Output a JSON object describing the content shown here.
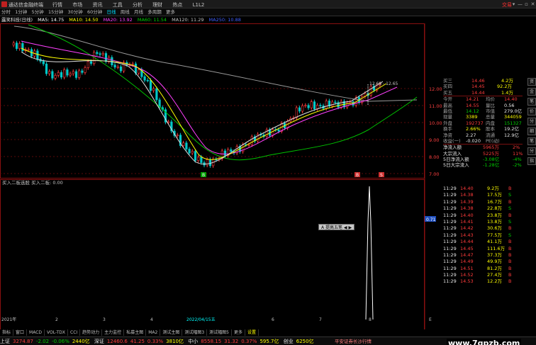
{
  "app": {
    "title": "通达信金融终端",
    "menu": [
      "行情",
      "市场",
      "资讯",
      "工具",
      "分析",
      "理财",
      "热点",
      "L1L2"
    ],
    "trade_label": "交易",
    "window_controls": [
      "▾",
      "—",
      "▫",
      "✕"
    ]
  },
  "period_tabs": [
    "分时",
    "1分钟",
    "5分钟",
    "15分钟",
    "30分钟",
    "60分钟",
    "日线",
    "周线",
    "月线",
    "多周期",
    "更多"
  ],
  "active_period": "日线",
  "ma_line": {
    "name": "露笑科技(日线)",
    "items": [
      {
        "label": "MA5: 14.75",
        "color": "#ffffff"
      },
      {
        "label": "MA10: 14.50",
        "color": "#ffff00"
      },
      {
        "label": "MA20: 13.92",
        "color": "#ff40ff"
      },
      {
        "label": "MA60: 11.54",
        "color": "#00d000"
      },
      {
        "label": "MA120: 11.29",
        "color": "#c0c0c0"
      },
      {
        "label": "MA250: 10.88",
        "color": "#4060ff"
      }
    ]
  },
  "price_axis": [
    "12.00",
    "11.00",
    "10.00",
    "9.00",
    "8.00",
    "7.00"
  ],
  "annotation_range": "12.69 - 12.65",
  "kline_markers": [
    "B",
    "B",
    "S"
  ],
  "sub_indicator": {
    "title": "买入二板选股  买入二板: 0.00",
    "axis_value": "0.71"
  },
  "time_axis": [
    "2021年",
    "2",
    "3",
    "4",
    "2022/04/15五",
    "6",
    "7",
    "8",
    "E"
  ],
  "popup_label": "A 提高五笔 ◀ ▶",
  "quote_top": [
    {
      "label": "买三",
      "price": "14.46",
      "vol": "4.2万"
    },
    {
      "label": "买四",
      "price": "14.45",
      "vol": "92.2万"
    },
    {
      "label": "买五",
      "price": "14.44",
      "vol": "1.4万"
    }
  ],
  "quote_stats": [
    {
      "l1": "今开",
      "v1": "14.21",
      "c1": "red",
      "l2": "均价",
      "v2": "14.40",
      "c2": "red"
    },
    {
      "l1": "最高",
      "v1": "14.55",
      "c1": "red",
      "l2": "量比",
      "v2": "0.56",
      "c2": "white"
    },
    {
      "l1": "最低",
      "v1": "14.12",
      "c1": "green",
      "l2": "市值",
      "v2": "279.0亿",
      "c2": "white"
    },
    {
      "l1": "现量",
      "v1": "3389",
      "c1": "yellow",
      "l2": "总量",
      "v2": "344059",
      "c2": "yellow"
    },
    {
      "l1": "外盘",
      "v1": "192737",
      "c1": "red",
      "l2": "内盘",
      "v2": "151327",
      "c2": "green"
    },
    {
      "l1": "换手",
      "v1": "2.66%",
      "c1": "yellow",
      "l2": "股本",
      "v2": "19.2亿",
      "c2": "white"
    },
    {
      "l1": "净资",
      "v1": "2.27",
      "c1": "white",
      "l2": "流通",
      "v2": "12.9亿",
      "c2": "white"
    },
    {
      "l1": "收益(一)",
      "v1": "-0.020",
      "c1": "white",
      "l2": "PE(动)",
      "v2": "",
      "c2": "white"
    }
  ],
  "fund_flow": [
    {
      "label": "净流入额",
      "value": "5965万",
      "pct": "2%",
      "color": "red"
    },
    {
      "label": "大宗流入",
      "value": "5225万",
      "pct": "11%",
      "color": "red"
    },
    {
      "label": "5日净流入额",
      "value": "-3.08亿",
      "pct": "-4%",
      "color": "green"
    },
    {
      "label": "5日大宗流入",
      "value": "-1.28亿",
      "pct": "-2%",
      "color": "green"
    }
  ],
  "ticks": [
    {
      "time": "11:29",
      "price": "14.40",
      "vol": "9.2万",
      "side": "B"
    },
    {
      "time": "11:29",
      "price": "14.38",
      "vol": "17.5万",
      "side": "S"
    },
    {
      "time": "11:29",
      "price": "14.39",
      "vol": "16.7万",
      "side": "B"
    },
    {
      "time": "11:29",
      "price": "14.38",
      "vol": "22.8万",
      "side": "S"
    },
    {
      "time": "11:29",
      "price": "14.40",
      "vol": "23.8万",
      "side": "B"
    },
    {
      "time": "11:29",
      "price": "14.41",
      "vol": "13.8万",
      "side": "S"
    },
    {
      "time": "11:29",
      "price": "14.42",
      "vol": "30.6万",
      "side": "B"
    },
    {
      "time": "11:29",
      "price": "14.43",
      "vol": "77.5万",
      "side": "S"
    },
    {
      "time": "11:29",
      "price": "14.44",
      "vol": "41.1万",
      "side": "B"
    },
    {
      "time": "11:29",
      "price": "14.45",
      "vol": "111.6万",
      "side": "B"
    },
    {
      "time": "11:29",
      "price": "14.47",
      "vol": "37.3万",
      "side": "B"
    },
    {
      "time": "11:29",
      "price": "14.49",
      "vol": "49.9万",
      "side": "B"
    },
    {
      "time": "11:29",
      "price": "14.51",
      "vol": "81.2万",
      "side": "B"
    },
    {
      "time": "11:29",
      "price": "14.52",
      "vol": "27.4万",
      "side": "B"
    },
    {
      "time": "11:29",
      "price": "14.53",
      "vol": "12.2万",
      "side": "B"
    }
  ],
  "indicator_tabs": [
    "指标",
    "窗口",
    "MACD",
    "VOL-TDX",
    "CCI",
    "趋势动力",
    "主力监控",
    "私募主图",
    "MA2",
    "测试主图",
    "测试幅图3",
    "测试幅图5",
    "更多",
    "设置"
  ],
  "function_tabs": [
    "扩展A",
    "关联报价",
    "资金分布",
    "综合资讯",
    "行业资讯",
    "互动问答",
    "省用户局制专章"
  ],
  "status": {
    "sh_label": "上证",
    "sh_index": "3274.87",
    "sh_chg": "-2.02",
    "sh_pct": "-0.06%",
    "sh_amt": "2440亿",
    "sz_label": "深证",
    "sz_index": "12460.6",
    "sz_chg": "41.25",
    "sz_pct": "0.33%",
    "sz_amt": "3810亿",
    "zx_label": "中小",
    "zx_index": "8558.15",
    "zx_chg": "31.32",
    "zx_pct": "0.37%",
    "zx_amt": "595.7亿",
    "cy_label": "创业",
    "cy_amt": "6250亿",
    "broker": "平安证券长沙行情",
    "side_label": "图文F10"
  },
  "watermark": "www.7gpzb.com",
  "right_tabs": [
    "资",
    "金",
    "笔",
    "价",
    "分",
    "细",
    "笔",
    "分",
    "指"
  ]
}
